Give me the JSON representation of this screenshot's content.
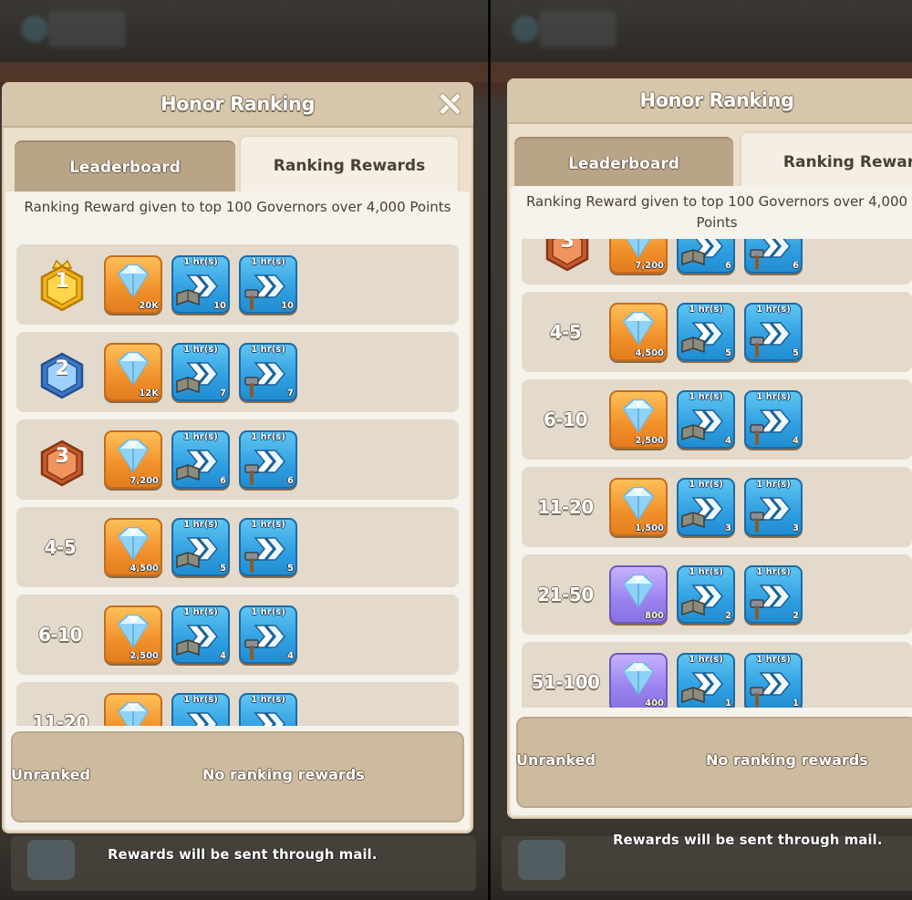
{
  "panel": {
    "title": "Honor Ranking",
    "tabs": [
      {
        "label": "Leaderboard",
        "active": false
      },
      {
        "label": "Ranking Rewards",
        "active": true
      }
    ],
    "right_tab_label_visible": "Ranking Rewar",
    "description": "Ranking Reward given to top 100 Governors over 4,000 Points",
    "unranked_label": "Unranked",
    "no_rewards": "No ranking rewards",
    "footer": "Rewards will be sent through mail."
  },
  "reward_tiers": [
    {
      "rank": "1",
      "medal": "gold",
      "gems": "20K",
      "gem_color": "orange",
      "hr_label": "1 hr(s)",
      "research_speedups": "10",
      "build_speedups": "10"
    },
    {
      "rank": "2",
      "medal": "silver",
      "gems": "12K",
      "gem_color": "orange",
      "hr_label": "1 hr(s)",
      "research_speedups": "7",
      "build_speedups": "7"
    },
    {
      "rank": "3",
      "medal": "bronze",
      "gems": "7,200",
      "gem_color": "orange",
      "hr_label": "1 hr(s)",
      "research_speedups": "6",
      "build_speedups": "6"
    },
    {
      "rank": "4-5",
      "medal": null,
      "gems": "4,500",
      "gem_color": "orange",
      "hr_label": "1 hr(s)",
      "research_speedups": "5",
      "build_speedups": "5"
    },
    {
      "rank": "6-10",
      "medal": null,
      "gems": "2,500",
      "gem_color": "orange",
      "hr_label": "1 hr(s)",
      "research_speedups": "4",
      "build_speedups": "4"
    },
    {
      "rank": "11-20",
      "medal": null,
      "gems": "1,500",
      "gem_color": "orange",
      "hr_label": "1 hr(s)",
      "research_speedups": "3",
      "build_speedups": "3"
    },
    {
      "rank": "21-50",
      "medal": null,
      "gems": "800",
      "gem_color": "purple",
      "hr_label": "1 hr(s)",
      "research_speedups": "2",
      "build_speedups": "2"
    },
    {
      "rank": "51-100",
      "medal": null,
      "gems": "400",
      "gem_color": "purple",
      "hr_label": "1 hr(s)",
      "research_speedups": "1",
      "build_speedups": "1"
    }
  ],
  "colors": {
    "panel_bg": "#ecdfcb",
    "gold_medal": "#f2b21b",
    "silver_medal": "#3d78c8",
    "bronze_medal": "#c55a2c",
    "speedup_blue": "#2f9fe0",
    "gem_orange": "#f0902a",
    "gem_purple": "#9a82ee"
  },
  "icons": {
    "gem": "gem-icon",
    "research_speedup": "book-chevron-icon",
    "build_speedup": "hammer-chevron-icon"
  }
}
